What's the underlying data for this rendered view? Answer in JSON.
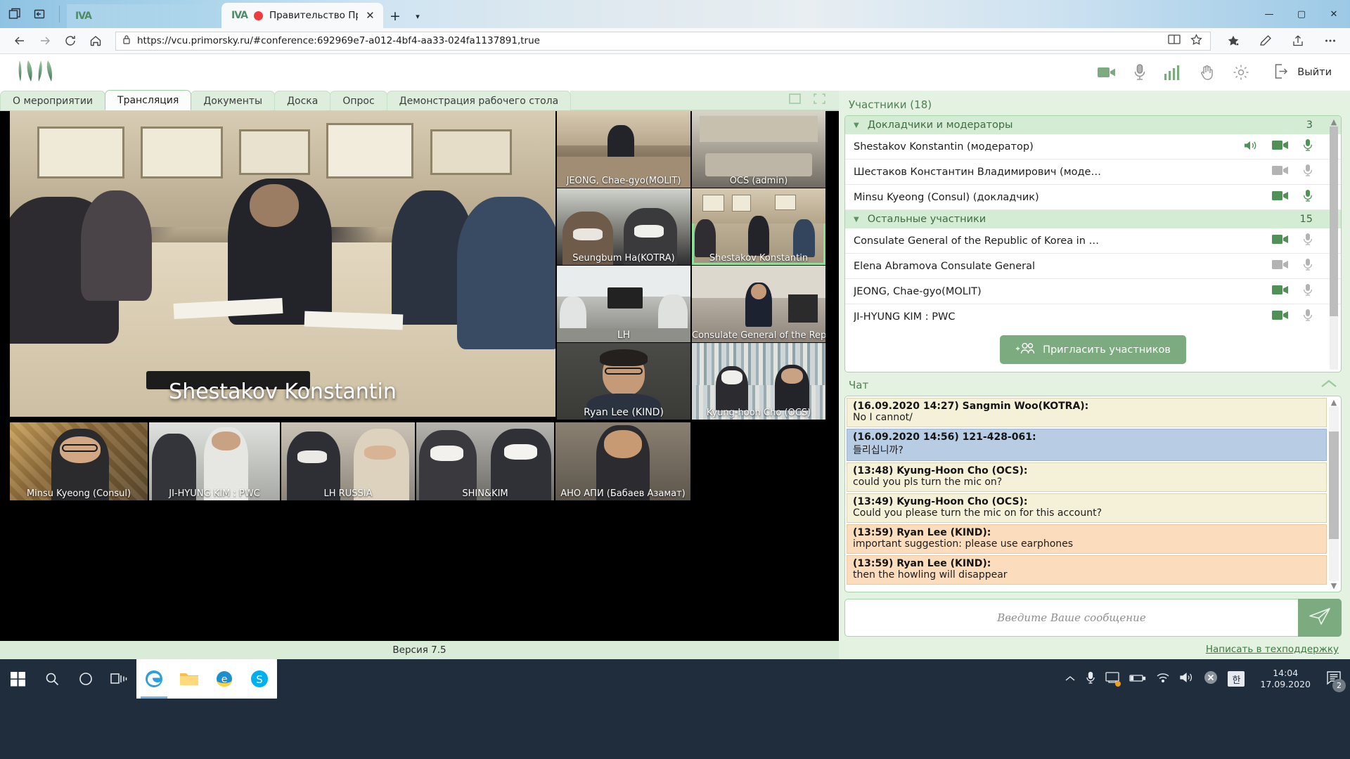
{
  "browser": {
    "inactive_tab_label": "IVA",
    "active_tab_title": "Правительство Пр",
    "url": "https://vcu.primorsky.ru/#conference:692969e7-a012-4bf4-aa33-024fa1137891,true",
    "icons": {
      "tab_overview": "tab-overview-icon",
      "collections": "collections-icon",
      "back": "back-arrow-icon",
      "forward": "forward-arrow-icon",
      "reload": "reload-icon",
      "home": "home-icon",
      "lock": "lock-icon",
      "reading_view": "reading-view-icon",
      "favorite": "star-icon",
      "favorites_bar": "favorites-icon",
      "pen": "pen-icon",
      "share": "share-icon",
      "settings": "ellipsis-icon",
      "minimize": "minimize-icon",
      "maximize": "maximize-icon",
      "close": "close-icon",
      "new_tab": "plus-icon",
      "tab_chevron": "chevron-down-icon"
    }
  },
  "app": {
    "logo": "IVA",
    "logout_label": "Выйти",
    "footer_version": "Версия 7.5",
    "header_icons": [
      "camera-icon",
      "microphone-icon",
      "signal-bars-icon",
      "raise-hand-icon",
      "gear-icon"
    ],
    "layout_icons": [
      "single-view-icon",
      "fullscreen-icon"
    ],
    "tabs": [
      {
        "label": "О мероприятии",
        "active": false
      },
      {
        "label": "Трансляция",
        "active": true
      },
      {
        "label": "Документы",
        "active": false
      },
      {
        "label": "Доска",
        "active": false
      },
      {
        "label": "Опрос",
        "active": false
      },
      {
        "label": "Демонстрация рабочего стола",
        "active": false
      }
    ]
  },
  "stage": {
    "main_tile": {
      "label": "Shestakov Konstantin",
      "speaking": false
    },
    "tiles": [
      {
        "label": "JEONG, Chae-gyo(MOLIT)",
        "speaking": false
      },
      {
        "label": "OCS (admin)",
        "speaking": false
      },
      {
        "label": "Seungbum Ha(KOTRA)",
        "speaking": false
      },
      {
        "label": "Shestakov Konstantin",
        "speaking": true
      },
      {
        "label": "LH",
        "speaking": false
      },
      {
        "label": "Consulate General of the Republi",
        "speaking": false
      },
      {
        "label": "Ryan Lee (KIND)",
        "speaking": false
      },
      {
        "label": "Kyung-hoon Cho (OCS)",
        "speaking": false
      }
    ],
    "bottom_tiles": [
      {
        "label": "Minsu Kyeong (Consul)"
      },
      {
        "label": "JI-HYUNG KIM : PWC"
      },
      {
        "label": "LH RUSSIA"
      },
      {
        "label": "SHIN&KIM"
      },
      {
        "label": "АНО АПИ (Бабаев Азамат)"
      }
    ]
  },
  "participants": {
    "title": "Участники (18)",
    "groups": [
      {
        "name": "Докладчики и модераторы",
        "count": "3",
        "members": [
          {
            "name": "Shestakov Konstantin (модератор)",
            "speaker_icon": true,
            "camera_on": true,
            "mic_on": true
          },
          {
            "name": "Шестаков Константин Владимирович (моде…",
            "speaker_icon": false,
            "camera_on": false,
            "mic_on": false
          },
          {
            "name": "Minsu Kyeong (Consul) (докладчик)",
            "speaker_icon": false,
            "camera_on": true,
            "mic_on": true
          }
        ]
      },
      {
        "name": "Остальные участники",
        "count": "15",
        "members": [
          {
            "name": "Consulate General of the Republic of Korea in …",
            "speaker_icon": false,
            "camera_on": true,
            "mic_on": false
          },
          {
            "name": "Elena Abramova Consulate General",
            "speaker_icon": false,
            "camera_on": false,
            "mic_on": false
          },
          {
            "name": "JEONG, Chae-gyo(MOLIT)",
            "speaker_icon": false,
            "camera_on": true,
            "mic_on": false
          },
          {
            "name": "JI-HYUNG KIM : PWC",
            "speaker_icon": false,
            "camera_on": true,
            "mic_on": false
          }
        ]
      }
    ],
    "invite_label": "Пригласить участников"
  },
  "chat": {
    "title": "Чат",
    "collapse_icon": "chevron-up-icon",
    "messages": [
      {
        "head": "(16.09.2020 14:27) Sangmin Woo(KOTRA):",
        "body": "No I cannot/",
        "style": "beige"
      },
      {
        "head": "(16.09.2020 14:56) 121-428-061:",
        "body": "들리십니까?",
        "style": "blue"
      },
      {
        "head": "(13:48) Kyung-Hoon Cho (OCS):",
        "body": "could you pls turn the mic on?",
        "style": "beige"
      },
      {
        "head": "(13:49) Kyung-Hoon Cho (OCS):",
        "body": "Could you please turn the mic on for this account?",
        "style": "beige"
      },
      {
        "head": "(13:59) Ryan Lee (KIND):",
        "body": "important suggestion: please use earphones",
        "style": "orange"
      },
      {
        "head": "(13:59) Ryan Lee (KIND):",
        "body": "then the howling will disappear",
        "style": "orange"
      }
    ],
    "composer_placeholder": "Введите Ваше сообщение",
    "send_icon": "send-paper-plane-icon",
    "support_link": "Написать в техподдержку"
  },
  "taskbar": {
    "start_icon": "windows-start-icon",
    "search_icon": "search-icon",
    "cortana_icon": "cortana-circle-icon",
    "taskview_icon": "task-view-icon",
    "apps": [
      "edge-icon",
      "file-explorer-icon",
      "ie-icon",
      "skype-icon"
    ],
    "tray_icons": [
      "chevron-up-icon",
      "microphone-icon",
      "screen-cast-icon",
      "battery-icon",
      "wifi-icon",
      "volume-icon",
      "onedrive-error-icon",
      "ime-korean-icon"
    ],
    "ime_label": "한",
    "clock_time": "14:04",
    "clock_date": "17.09.2020",
    "notification_count": "2"
  },
  "colors": {
    "accent_green": "#7cab7f",
    "panel_green": "#e4f2e2",
    "tab_green": "#ddeedd",
    "taskbar": "#1f2d3d",
    "rec_red": "#ef3b3b"
  }
}
